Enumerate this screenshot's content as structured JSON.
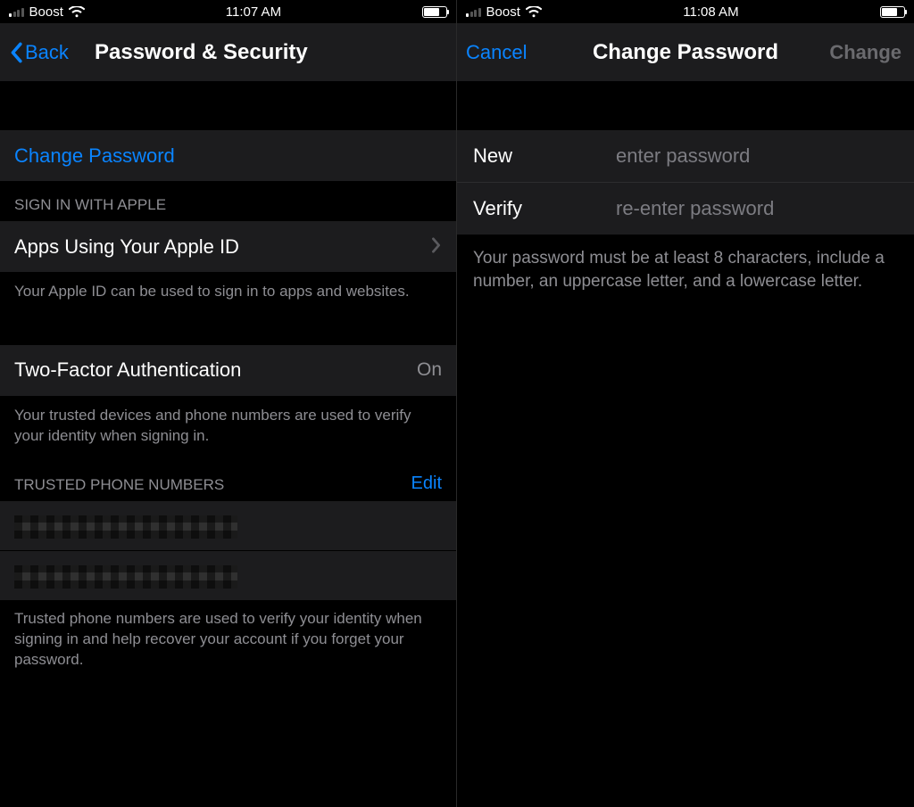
{
  "left": {
    "status": {
      "carrier": "Boost",
      "time": "11:07 AM"
    },
    "nav": {
      "back": "Back",
      "title": "Password & Security"
    },
    "change_password_label": "Change Password",
    "sign_in_header": "SIGN IN WITH APPLE",
    "apps_row_label": "Apps Using Your Apple ID",
    "apps_footer": "Your Apple ID can be used to sign in to apps and websites.",
    "tfa_label": "Two-Factor Authentication",
    "tfa_value": "On",
    "tfa_footer": "Your trusted devices and phone numbers are used to verify your identity when signing in.",
    "trusted_header": "TRUSTED PHONE NUMBERS",
    "edit_label": "Edit",
    "trusted_footer": "Trusted phone numbers are used to verify your identity when signing in and help recover your account if you forget your password."
  },
  "right": {
    "status": {
      "carrier": "Boost",
      "time": "11:08 AM"
    },
    "nav": {
      "cancel": "Cancel",
      "title": "Change Password",
      "change": "Change"
    },
    "fields": {
      "new_label": "New",
      "new_placeholder": "enter password",
      "verify_label": "Verify",
      "verify_placeholder": "re-enter password"
    },
    "hint": "Your password must be at least 8 characters, include a number, an uppercase letter, and a lowercase letter."
  }
}
